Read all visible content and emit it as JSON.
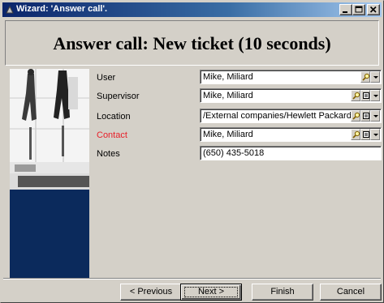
{
  "window": {
    "title": "Wizard: 'Answer call'.",
    "controls": [
      "minimize",
      "maximize",
      "close"
    ]
  },
  "header": {
    "title": "Answer call: New ticket (10 seconds)"
  },
  "form": {
    "fields": [
      {
        "label": "User",
        "value": "Mike, Miliard",
        "required": false,
        "buttons": [
          "magnifier-icon",
          "dropdown-arrow-icon"
        ]
      },
      {
        "label": "Supervisor",
        "value": "Mike, Miliard",
        "required": false,
        "buttons": [
          "magnifier-icon",
          "details-icon",
          "dropdown-arrow-icon"
        ]
      },
      {
        "label": "Location",
        "value": "/External companies/Hewlett Packard/E",
        "required": false,
        "buttons": [
          "magnifier-icon",
          "details-icon",
          "dropdown-arrow-icon"
        ]
      },
      {
        "label": "Contact",
        "value": "Mike, Miliard",
        "required": true,
        "buttons": [
          "magnifier-icon",
          "details-icon",
          "dropdown-arrow-icon"
        ]
      },
      {
        "label": "Notes",
        "value": "(650) 435-5018",
        "required": false,
        "buttons": []
      }
    ]
  },
  "buttons": {
    "previous": "< Previous",
    "next": "Next >",
    "finish": "Finish",
    "cancel": "Cancel"
  },
  "colors": {
    "titlebar_start": "#0a246a",
    "titlebar_end": "#a6caf0",
    "dialog_face": "#d4d0c8",
    "required_label": "#e8202a",
    "photo_panel_blue": "#0b2a5c"
  }
}
